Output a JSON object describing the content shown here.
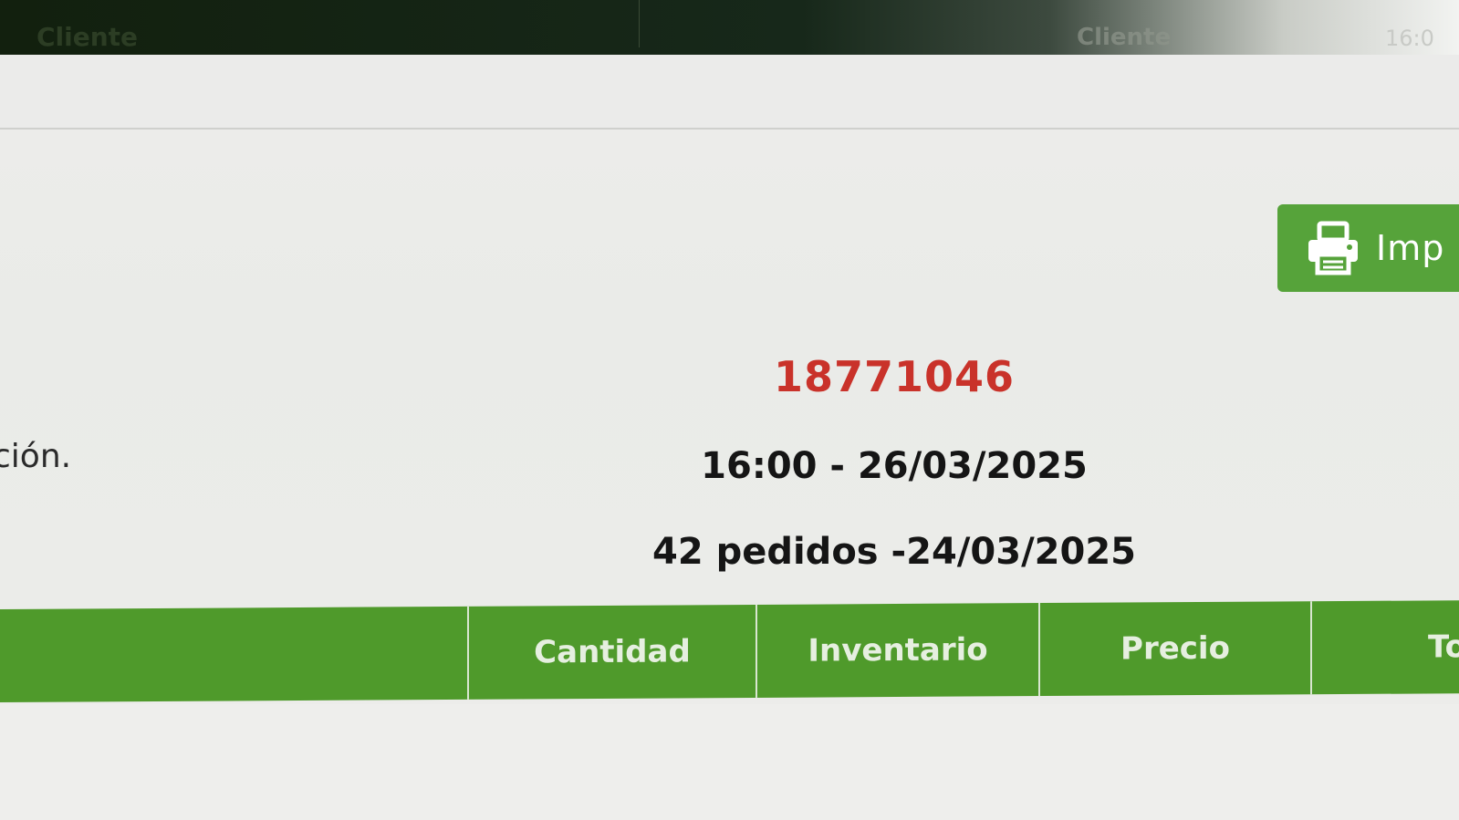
{
  "header": {
    "left_label": "Cliente",
    "right_label": "Cliente",
    "time_fragment": "16:0"
  },
  "print_button": {
    "label": "Imp",
    "icon": "printer-icon"
  },
  "left_text": "ción.",
  "order": {
    "number": "18771046",
    "time_date": "16:00 - 26/03/2025",
    "count_date": "42 pedidos -24/03/2025"
  },
  "table": {
    "columns": [
      "",
      "Cantidad",
      "Inventario",
      "Precio",
      "To"
    ]
  },
  "colors": {
    "accent_green": "#56a33a",
    "order_number_red": "#c9322a",
    "header_dark": "#12200e"
  }
}
